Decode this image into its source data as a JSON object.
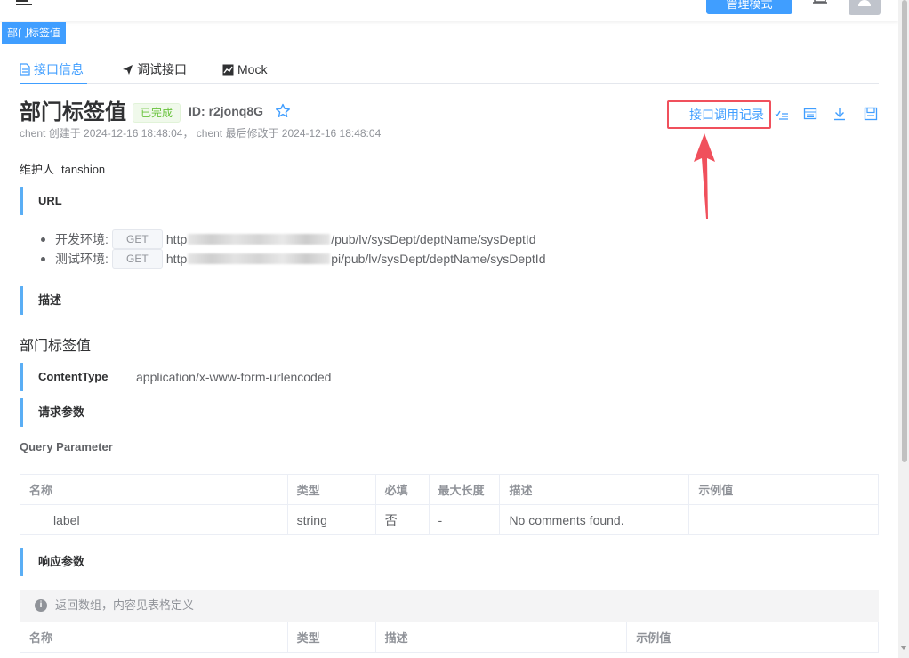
{
  "header": {
    "admin_mode_label": "管理模式"
  },
  "page_tag": "部门标签值",
  "tabs": [
    {
      "label": "接口信息",
      "icon": "document-icon",
      "active": true
    },
    {
      "label": "调试接口",
      "icon": "paper-plane-icon",
      "active": false
    },
    {
      "label": "Mock",
      "icon": "chart-icon",
      "active": false
    }
  ],
  "api": {
    "title": "部门标签值",
    "status": "已完成",
    "id_label": "ID:",
    "id": "r2jonq8G",
    "meta": "chent 创建于 2024-12-16 18:48:04， chent 最后修改于 2024-12-16 18:48:04",
    "call_record_label": "接口调用记录",
    "maintainer_label": "维护人",
    "maintainer": "tanshion"
  },
  "sections": {
    "url": "URL",
    "desc": "描述",
    "content_type": "ContentType",
    "request_params": "请求参数",
    "response_params": "响应参数"
  },
  "environments": [
    {
      "label": "开发环境:",
      "method": "GET",
      "url_prefix": "http",
      "url_suffix": "/pub/lv/sysDept/deptName/sysDeptId"
    },
    {
      "label": "测试环境:",
      "method": "GET",
      "url_prefix": "http",
      "url_suffix": "pi/pub/lv/sysDept/deptName/sysDeptId"
    }
  ],
  "description_text": "部门标签值",
  "content_type_value": "application/x-www-form-urlencoded",
  "query_parameter_label": "Query Parameter",
  "query_table": {
    "headers": [
      "名称",
      "类型",
      "必填",
      "最大长度",
      "描述",
      "示例值"
    ],
    "rows": [
      [
        "label",
        "string",
        "否",
        "-",
        "No comments found.",
        ""
      ]
    ]
  },
  "response_alert": "返回数组，内容见表格定义",
  "response_table": {
    "headers": [
      "名称",
      "类型",
      "描述",
      "示例值"
    ]
  },
  "colors": {
    "primary": "#409eff",
    "success": "#67c23a",
    "highlight_border": "#f0505c",
    "section_bar": "#5aaef5"
  }
}
